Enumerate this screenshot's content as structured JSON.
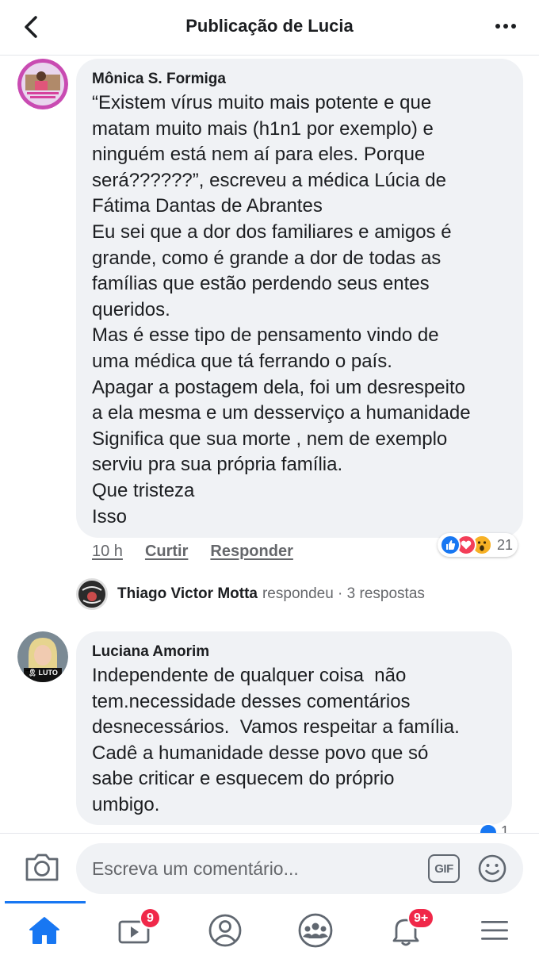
{
  "header": {
    "title": "Publicação de Lucia"
  },
  "comments": [
    {
      "author": "Mônica S. Formiga",
      "text": "“Existem vírus muito mais potente e que\nmatam muito mais (h1n1 por exemplo) e\nninguém está nem aí para eles. Porque\nserá??????”, escreveu a médica Lúcia de\nFátima Dantas de Abrantes\nEu sei que a dor dos familiares e amigos é\ngrande, como é grande a dor de todas as\nfamílias que estão perdendo seus entes\nqueridos.\nMas é esse tipo de pensamento vindo de\numa médica que tá ferrando o país.\nApagar a postagem dela, foi um desrespeito\na ela mesma e um desserviço a humanidade\nSignifica que sua morte , nem de exemplo\nserviu pra sua própria família.\nQue tristeza\nIsso",
      "time": "10 h",
      "like_label": "Curtir",
      "reply_label": "Responder",
      "reaction_count": "21",
      "reactions": [
        "like-icon",
        "love-icon",
        "wow-icon"
      ],
      "replies": {
        "name": "Thiago Victor Motta",
        "action": "respondeu · 3 respostas"
      }
    },
    {
      "author": "Luciana Amorim",
      "text": "Independente de qualquer coisa  não\ntem.necessidade desses comentários\ndesnecessários.  Vamos respeitar a família.\nCadê a humanidade desse povo que só\nsabe criticar e esquecem do próprio\numbigo.",
      "reaction_count": "1",
      "badge_text": "LUTO"
    }
  ],
  "composer": {
    "placeholder": "Escreva um comentário...",
    "gif_label": "GIF"
  },
  "tabbar": {
    "tabs": [
      {
        "icon": "home-icon",
        "active": true
      },
      {
        "icon": "video-icon",
        "badge": "9"
      },
      {
        "icon": "profile-icon"
      },
      {
        "icon": "groups-icon"
      },
      {
        "icon": "bell-icon",
        "badge": "9+"
      },
      {
        "icon": "menu-icon"
      }
    ]
  },
  "colors": {
    "accent": "#1877f2",
    "bubble": "#f0f2f5",
    "badge": "#f02849",
    "secondary_text": "#65676b"
  }
}
